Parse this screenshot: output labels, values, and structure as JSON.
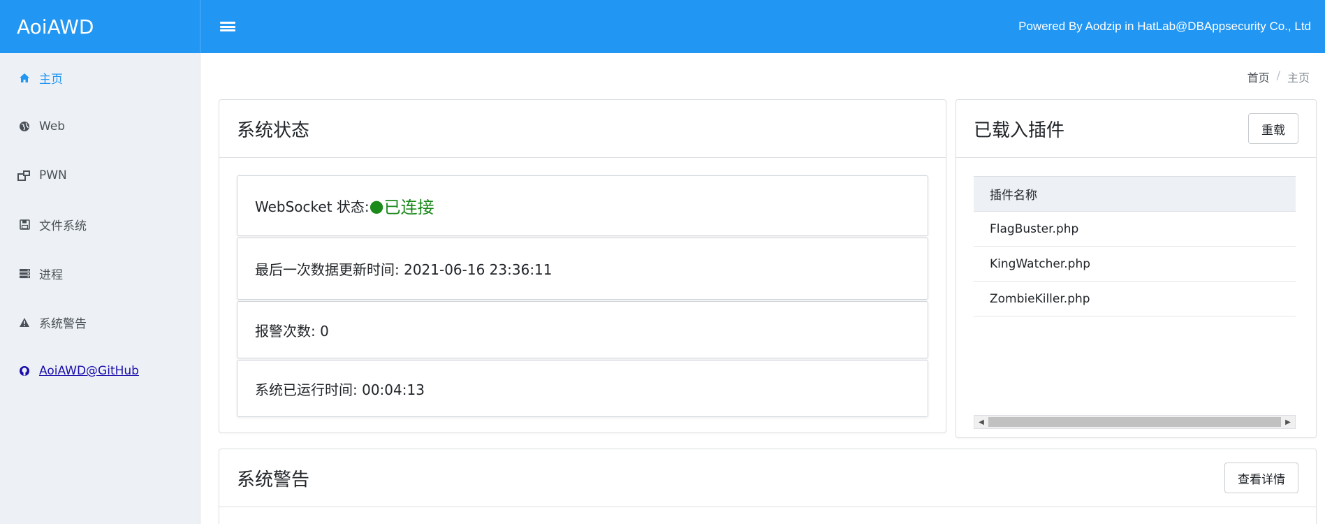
{
  "app": {
    "brand": "AoiAWD",
    "powered_by": "Powered By Aodzip in HatLab@DBAppsecurity Co., Ltd"
  },
  "sidebar": {
    "items": [
      {
        "label": "主页",
        "icon": "home-icon",
        "active": true
      },
      {
        "label": "Web",
        "icon": "globe-icon"
      },
      {
        "label": "PWN",
        "icon": "windows-icon"
      },
      {
        "label": "文件系统",
        "icon": "floppy-icon"
      },
      {
        "label": "进程",
        "icon": "server-icon"
      },
      {
        "label": "系统警告",
        "icon": "warning-icon"
      },
      {
        "label": "AoiAWD@GitHub",
        "icon": "github-icon",
        "link": true
      }
    ]
  },
  "breadcrumb": {
    "home": "首页",
    "separator": "/",
    "current": "主页"
  },
  "status_card": {
    "title": "系统状态",
    "websocket_label": "WebSocket 状态: ",
    "websocket_dot": "●",
    "websocket_value": "已连接",
    "last_update": "最后一次数据更新时间: 2021-06-16 23:36:11",
    "alert_count": "报警次数: 0",
    "uptime": "系统已运行时间: 00:04:13"
  },
  "plugins_card": {
    "title": "已载入插件",
    "reload_label": "重载",
    "column": "插件名称",
    "plugins": [
      "FlagBuster.php",
      "KingWatcher.php",
      "ZombieKiller.php"
    ]
  },
  "alert_card": {
    "title": "系统警告",
    "details_label": "查看详情"
  },
  "colors": {
    "primary": "#2196f3",
    "connected": "#1a8a1a",
    "sidebar_bg": "#edf1f5"
  }
}
